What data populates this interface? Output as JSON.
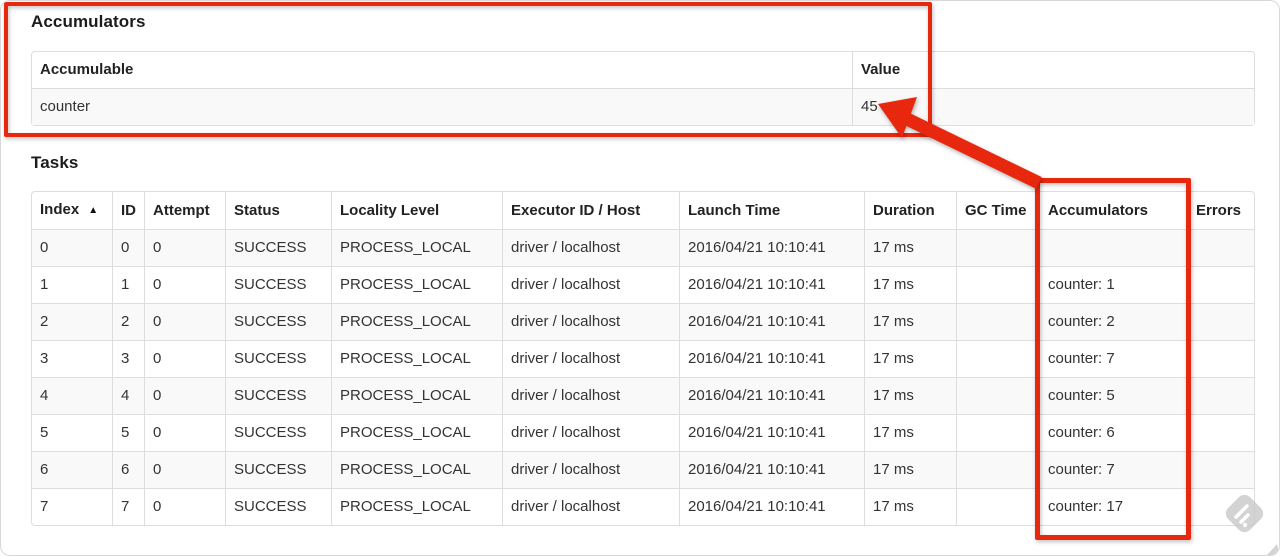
{
  "accumulators_section": {
    "title": "Accumulators",
    "table": {
      "headers": [
        "Accumulable",
        "Value"
      ],
      "rows": [
        [
          "counter",
          "45"
        ]
      ]
    }
  },
  "tasks_section": {
    "title": "Tasks",
    "table": {
      "headers": [
        "Index",
        "ID",
        "Attempt",
        "Status",
        "Locality Level",
        "Executor ID / Host",
        "Launch Time",
        "Duration",
        "GC Time",
        "Accumulators",
        "Errors"
      ],
      "sorted_by": "Index",
      "sort_indicator": "▲",
      "rows": [
        [
          "0",
          "0",
          "0",
          "SUCCESS",
          "PROCESS_LOCAL",
          "driver / localhost",
          "2016/04/21 10:10:41",
          "17 ms",
          "",
          "",
          ""
        ],
        [
          "1",
          "1",
          "0",
          "SUCCESS",
          "PROCESS_LOCAL",
          "driver / localhost",
          "2016/04/21 10:10:41",
          "17 ms",
          "",
          "counter: 1",
          ""
        ],
        [
          "2",
          "2",
          "0",
          "SUCCESS",
          "PROCESS_LOCAL",
          "driver / localhost",
          "2016/04/21 10:10:41",
          "17 ms",
          "",
          "counter: 2",
          ""
        ],
        [
          "3",
          "3",
          "0",
          "SUCCESS",
          "PROCESS_LOCAL",
          "driver / localhost",
          "2016/04/21 10:10:41",
          "17 ms",
          "",
          "counter: 7",
          ""
        ],
        [
          "4",
          "4",
          "0",
          "SUCCESS",
          "PROCESS_LOCAL",
          "driver / localhost",
          "2016/04/21 10:10:41",
          "17 ms",
          "",
          "counter: 5",
          ""
        ],
        [
          "5",
          "5",
          "0",
          "SUCCESS",
          "PROCESS_LOCAL",
          "driver / localhost",
          "2016/04/21 10:10:41",
          "17 ms",
          "",
          "counter: 6",
          ""
        ],
        [
          "6",
          "6",
          "0",
          "SUCCESS",
          "PROCESS_LOCAL",
          "driver / localhost",
          "2016/04/21 10:10:41",
          "17 ms",
          "",
          "counter: 7",
          ""
        ],
        [
          "7",
          "7",
          "0",
          "SUCCESS",
          "PROCESS_LOCAL",
          "driver / localhost",
          "2016/04/21 10:10:41",
          "17 ms",
          "",
          "counter: 17",
          ""
        ]
      ]
    }
  },
  "annotations": {
    "color": "#e8270f",
    "box1_target": "Accumulators section table",
    "box2_target": "Accumulators column of Tasks table",
    "arrow_points_to": "45"
  }
}
